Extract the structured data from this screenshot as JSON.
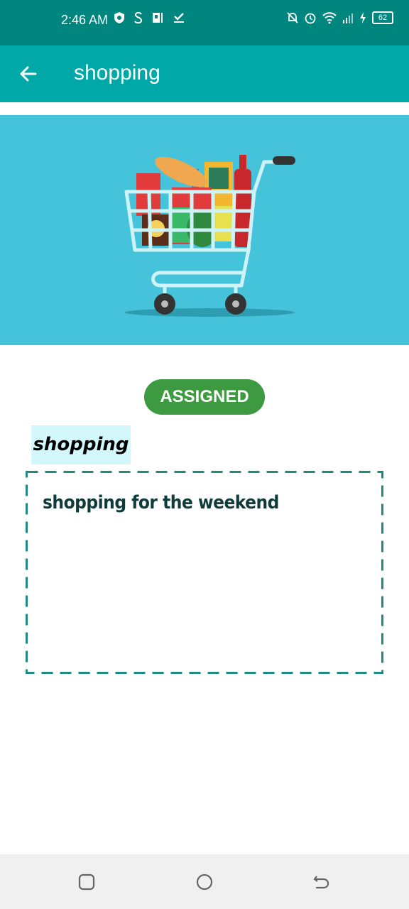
{
  "status_bar": {
    "time": "2:46 AM",
    "battery": "62",
    "left_icons": [
      "shield-icon",
      "s-badge-icon",
      "pr-icon",
      "download-done-icon"
    ],
    "right_icons": [
      "mute-bell-icon",
      "alarm-icon",
      "wifi-icon",
      "signal-icon",
      "charging-icon"
    ]
  },
  "app_bar": {
    "title": "shopping",
    "back_icon": "arrow-back-icon",
    "background": "#00a8a8"
  },
  "hero": {
    "image": "shopping-cart-illustration",
    "background": "#44c3db"
  },
  "task": {
    "status": "ASSIGNED",
    "status_color": "#3d9a40",
    "title": "shopping",
    "description": "shopping for the weekend"
  },
  "nav_bar": {
    "buttons": [
      "recents-icon",
      "home-icon",
      "back-icon"
    ]
  }
}
